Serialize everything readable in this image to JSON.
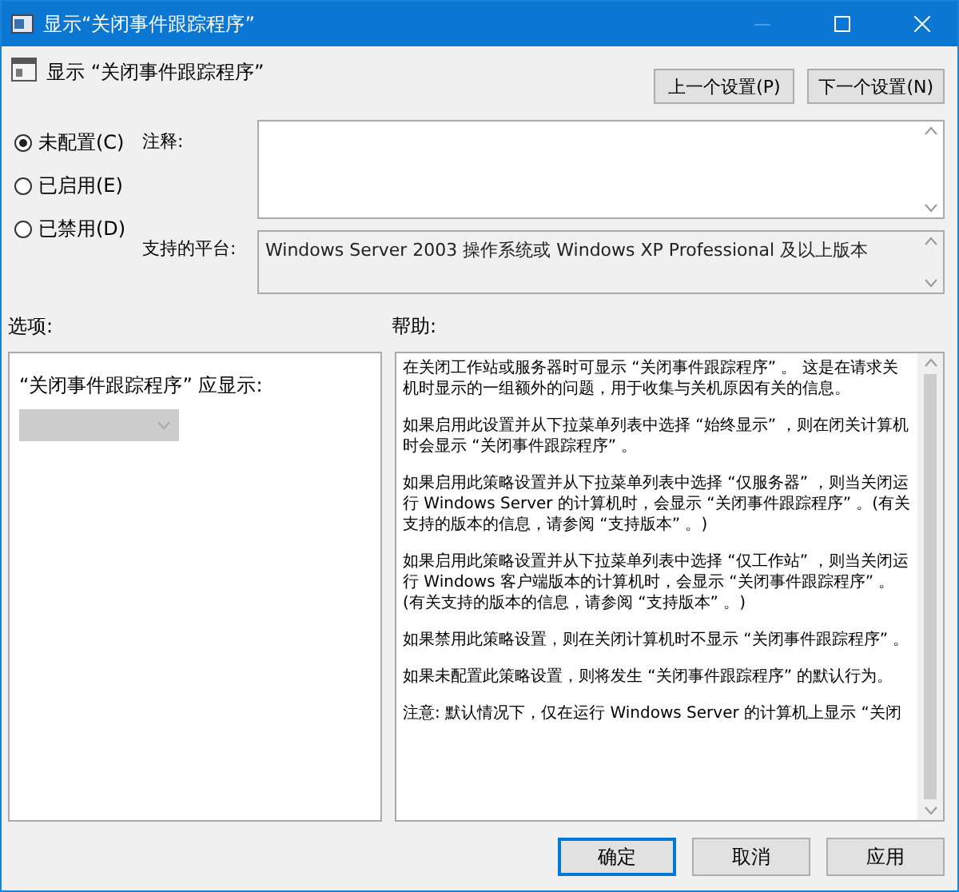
{
  "window": {
    "title": "显示“关闭事件跟踪程序”"
  },
  "header": {
    "title": "显示 “关闭事件跟踪程序”"
  },
  "nav_buttons": [
    "上一个设置(P)",
    "下一个设置(N)"
  ],
  "radios": [
    {
      "label": "未配置(C)",
      "selected": true
    },
    {
      "label": "已启用(E)",
      "selected": false
    },
    {
      "label": "已禁用(D)",
      "selected": false
    }
  ],
  "comment": {
    "label": "注释:"
  },
  "platform": {
    "label": "支持的平台:",
    "value": "Windows Server 2003 操作系统或 Windows XP Professional 及以上版本"
  },
  "options": {
    "label": "选项:",
    "prompt": "“关闭事件跟踪程序” 应显示:",
    "dropdown": {
      "disabled": true
    }
  },
  "help": {
    "label": "帮助:",
    "paragraphs": [
      "在关闭工作站或服务器时可显示 “关闭事件跟踪程序” 。 这是在请求关机时显示的一组额外的问题，用于收集与关机原因有关的信息。",
      "如果启用此设置并从下拉菜单列表中选择 “始终显示” ，则在闭关计算机时会显示 “关闭事件跟踪程序” 。",
      "如果启用此策略设置并从下拉菜单列表中选择 “仅服务器” ，则当关闭运行 Windows Server 的计算机时，会显示 “关闭事件跟踪程序” 。(有关支持的版本的信息，请参阅 “支持版本” 。)",
      "如果启用此策略设置并从下拉菜单列表中选择 “仅工作站” ，则当关闭运行 Windows 客户端版本的计算机时，会显示 “关闭事件跟踪程序” 。(有关支持的版本的信息，请参阅 “支持版本” 。)",
      "如果禁用此策略设置，则在关闭计算机时不显示 “关闭事件跟踪程序” 。",
      "如果未配置此策略设置，则将发生 “关闭事件跟踪程序” 的默认行为。",
      "注意: 默认情况下，仅在运行 Windows Server 的计算机上显示 “关闭"
    ]
  },
  "buttons": [
    {
      "label": "确定",
      "default": true
    },
    {
      "label": "取消",
      "default": false
    },
    {
      "label": "应用",
      "default": false
    }
  ]
}
